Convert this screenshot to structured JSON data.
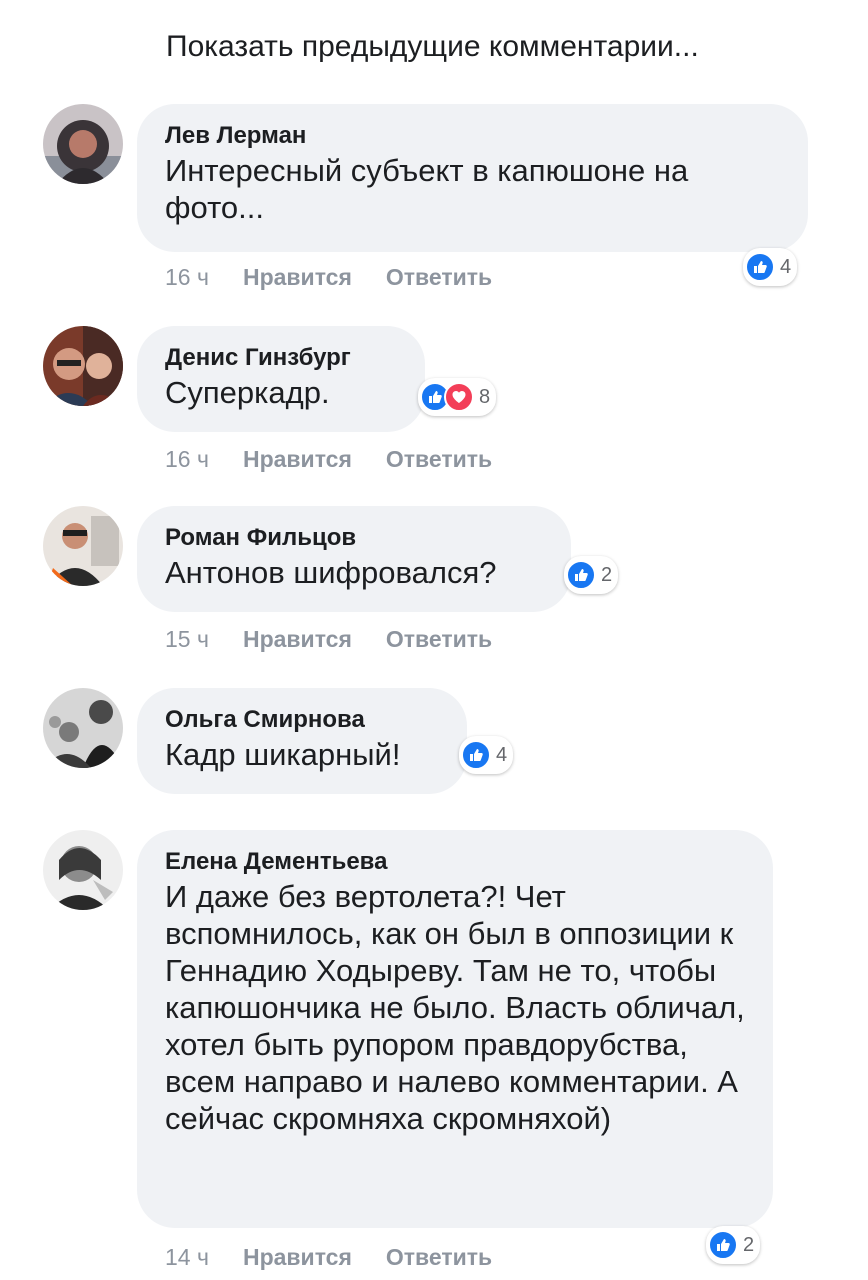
{
  "show_previous": "Показать предыдущие комментарии...",
  "actions": {
    "like": "Нравится",
    "reply": "Ответить"
  },
  "colors": {
    "bubble": "#f0f2f5",
    "like": "#1877f2",
    "love": "#f33e58",
    "meta": "#8d949e"
  },
  "comments": [
    {
      "author": "Лев Лерман",
      "text": "Интересный субъект в капюшоне на фото...",
      "time": "16 ч",
      "reactions": [
        "like"
      ],
      "count": "4"
    },
    {
      "author": "Денис Гинзбург",
      "text": "Суперкадр.",
      "time": "16 ч",
      "reactions": [
        "like",
        "love"
      ],
      "count": "8"
    },
    {
      "author": "Роман Фильцов",
      "text": "Антонов шифровался?",
      "time": "15 ч",
      "reactions": [
        "like"
      ],
      "count": "2"
    },
    {
      "author": "Ольга Смирнова",
      "text": "Кадр шикарный!",
      "time": "",
      "reactions": [
        "like"
      ],
      "count": "4"
    },
    {
      "author": "Елена Дементьева",
      "text": "И даже без вертолета?! Чет вспомнилось, как он был в оппозиции к Геннадию Ходыреву. Там не то, чтобы капюшончика не было. Власть обличал, хотел быть рупором правдорубства, всем направо и налево комментарии. А сейчас скромняха скромняхой)",
      "time": "14 ч",
      "reactions": [
        "like"
      ],
      "count": "2"
    }
  ]
}
